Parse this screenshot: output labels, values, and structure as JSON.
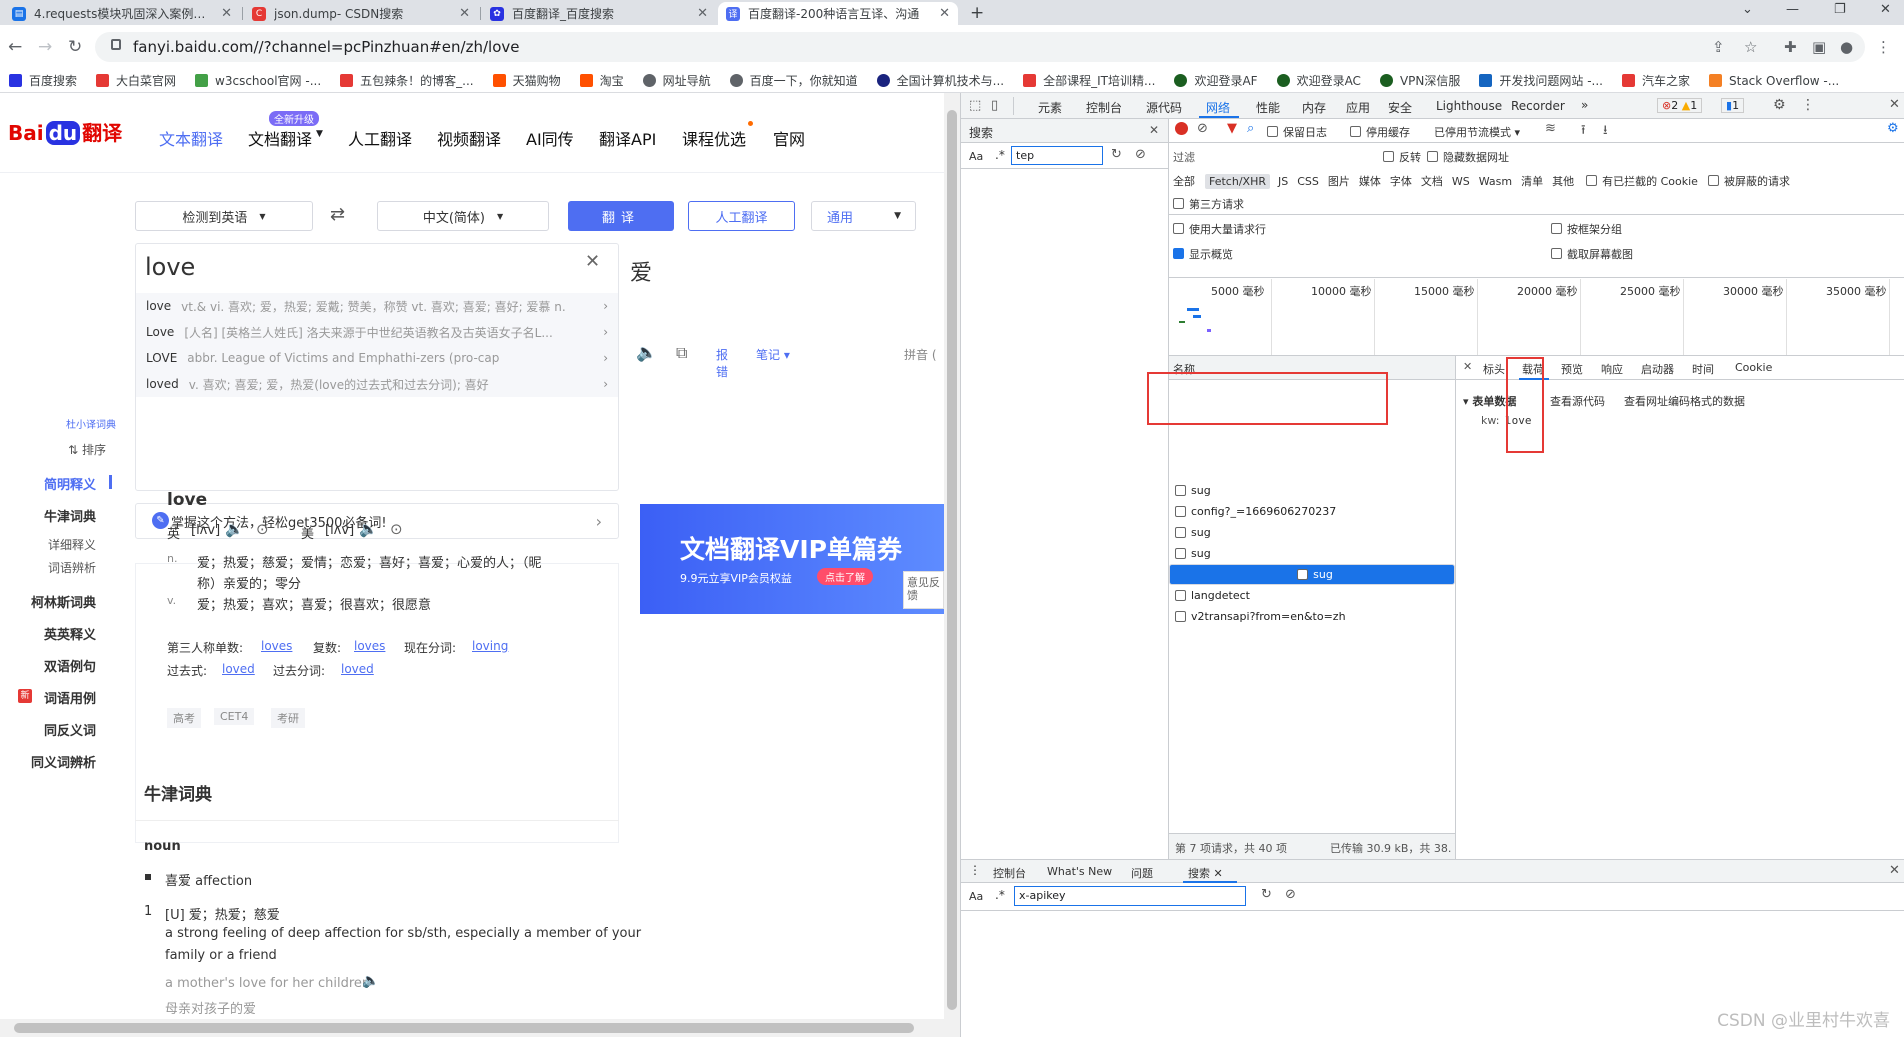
{
  "browser": {
    "tabs": [
      {
        "title": "4.requests模块巩固深入案例之毒",
        "icon": "csdn"
      },
      {
        "title": "json.dump- CSDN搜索",
        "icon": "csdn"
      },
      {
        "title": "百度翻译_百度搜索",
        "icon": "baidu"
      },
      {
        "title": "百度翻译-200种语言互译、沟通",
        "icon": "fanyi"
      }
    ],
    "url": "fanyi.baidu.com//?channel=pcPinzhuan#en/zh/love",
    "bookmarks": [
      "百度搜索",
      "大白菜官网",
      "w3cschool官网 -...",
      "五包辣条！的博客_...",
      "天猫购物",
      "淘宝",
      "网址导航",
      "百度一下，你就知道",
      "全国计算机技术与...",
      "全部课程_IT培训精...",
      "欢迎登录AF",
      "欢迎登录AC",
      "VPN深信服",
      "开发找问题网站 -...",
      "汽车之家",
      "Stack Overflow -..."
    ]
  },
  "site": {
    "logo": {
      "a": "Bai",
      "b": "du",
      "c": "翻译"
    },
    "nav": [
      "文本翻译",
      "文档翻译",
      "人工翻译",
      "视频翻译",
      "AI同传",
      "翻译API",
      "课程优选",
      "官网"
    ],
    "upgrade_badge": "全新升级",
    "src_lang": "检测到英语",
    "tgt_lang": "中文(简体)",
    "translate_btn": "翻译",
    "human_btn": "人工翻译",
    "general_sel": "通用",
    "src_text": "love",
    "tgt_text": "爱",
    "suggestions": [
      {
        "w": "love",
        "d": "vt.& vi. 喜欢; 爱，热爱; 爱戴; 赞美，称赞 vt. 喜欢; 喜爱; 喜好; 爱慕 n."
      },
      {
        "w": "Love",
        "d": "[人名] [英格兰人姓氏] 洛夫来源于中世纪英语教名及古英语女子名L..."
      },
      {
        "w": "LOVE",
        "d": "abbr. League of Victims and Emphathi-zers (pro-cap"
      },
      {
        "w": "loved",
        "d": "v. 喜欢; 喜爱; 爱，热爱(love的过去式和过去分词); 喜好"
      }
    ],
    "tgt_tools": {
      "report": "报错",
      "note": "笔记",
      "pinyin": "拼音"
    },
    "tip": "掌握这个方法，轻松get3500必备词!",
    "ad": {
      "title": "文档翻译VIP单篇券",
      "sub": "9.9元立享VIP会员权益",
      "btn": "点击了解"
    },
    "feedback": "意见反馈",
    "dict_nav": [
      {
        "t": "杜小译词典",
        "sub": true
      },
      {
        "t": "⇅ 排序",
        "sub": true
      },
      {
        "t": "简明释义",
        "active": true
      },
      {
        "t": "牛津词典"
      },
      {
        "t": "详细释义",
        "sub": true
      },
      {
        "t": "词语辨析",
        "sub": true
      },
      {
        "t": "柯林斯词典"
      },
      {
        "t": "英英释义"
      },
      {
        "t": "双语例句"
      },
      {
        "t": "词语用例"
      },
      {
        "t": "同反义词"
      },
      {
        "t": "同义词辨析"
      }
    ],
    "dict": {
      "word": "love",
      "uk": "英",
      "uk_ph": "[lʌv]",
      "us": "美",
      "us_ph": "[lʌv]",
      "n_pos": "n.",
      "n_def": "爱；热爱；慈爱；爱情；恋爱；喜好；喜爱；心爱的人；（昵",
      "n_def2": "称）亲爱的；零分",
      "v_pos": "v.",
      "v_def": "爱；热爱；喜欢；喜爱；很喜欢；很愿意",
      "forms1_a": "第三人称单数:",
      "forms1_b": "loves",
      "forms1_c": "复数:",
      "forms1_d": "loves",
      "forms1_e": "现在分词:",
      "forms1_f": "loving",
      "forms2_a": "过去式:",
      "forms2_b": "loved",
      "forms2_c": "过去分词:",
      "forms2_d": "loved",
      "tags": [
        "高考",
        "CET4",
        "考研"
      ]
    },
    "oxford": {
      "title": "牛津词典",
      "pos": "noun",
      "bullet": "喜爱 affection",
      "num": "1",
      "def_zh": "[U] 爱；热爱；慈爱",
      "def_en1": "a strong feeling of deep affection for sb/sth, especially a member of your",
      "def_en2": "family or a friend",
      "ex_en": "a mother's love for her children",
      "ex_zh": "母亲对孩子的爱"
    }
  },
  "devtools": {
    "search_panel": "搜索",
    "search_value": "tep",
    "aa": "Aa",
    "tabs": [
      "元素",
      "控制台",
      "源代码",
      "网络",
      "性能",
      "内存",
      "应用",
      "安全",
      "Lighthouse",
      "Recorder"
    ],
    "errors": "2",
    "warnings": "1",
    "issues": "1",
    "toolbar": {
      "preserve": "保留日志",
      "disable_cache": "停用缓存",
      "throttle": "已停用节流模式"
    },
    "filter_label": "过滤",
    "invert": "反转",
    "hide_data": "隐藏数据网址",
    "types": [
      "全部",
      "Fetch/XHR",
      "JS",
      "CSS",
      "图片",
      "媒体",
      "字体",
      "文档",
      "WS",
      "Wasm",
      "清单",
      "其他"
    ],
    "blocked_cookie": "有已拦截的 Cookie",
    "blocked_req": "被屏蔽的请求",
    "third_party": "第三方请求",
    "big_rows": "使用大量请求行",
    "group_frame": "按框架分组",
    "show_overview": "显示概览",
    "capture_ss": "截取屏幕截图",
    "timeline": [
      "5000 毫秒",
      "10000 毫秒",
      "15000 毫秒",
      "20000 毫秒",
      "25000 毫秒",
      "30000 毫秒",
      "35000 毫秒"
    ],
    "name_header": "名称",
    "requests": [
      "sug",
      "config?_=1669606270237",
      "sug",
      "sug",
      "sug",
      "langdetect",
      "v2transapi?from=en&to=zh"
    ],
    "detail_tabs": [
      "标头",
      "载荷",
      "预览",
      "响应",
      "启动器",
      "时间",
      "Cookie"
    ],
    "form_data": "▾ 表单数据",
    "view_source": "查看源代码",
    "view_url": "查看网址编码格式的数据",
    "kw_key": "kw:",
    "kw_val": "love",
    "status": "第 7 项请求，共 40 项",
    "transfer": "已传输 30.9 kB，共 38.8 kB",
    "drawer_tabs": [
      "控制台",
      "What's New",
      "问题",
      "搜索"
    ],
    "drawer_search": "x-apikey"
  },
  "watermark": "CSDN @业里村牛欢喜"
}
